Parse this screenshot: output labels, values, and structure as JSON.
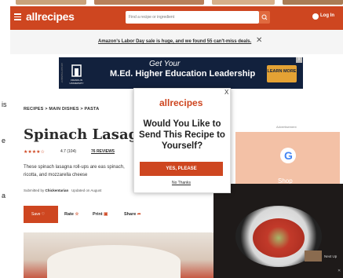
{
  "left_strip": {
    "lines": [
      "is",
      "e",
      "a"
    ]
  },
  "header": {
    "logo": "allrecipes",
    "search_placeholder": "Find a recipe or ingredient",
    "login_label": "Log In",
    "accent": "#ce4620"
  },
  "promo": {
    "text": "Amazon's Labor Day sale is huge, and we found 55 can't-miss deals.",
    "close": "✕"
  },
  "ad_banner": {
    "brand": "FRANKLIN",
    "brand_sub": "UNIVERSITY",
    "line1": "Get Your",
    "line2": "M.Ed. Higher Education Leadership",
    "cta": "LEARN MORE",
    "close": "X"
  },
  "article": {
    "breadcrumb": "RECIPES  >  MAIN DISHES  >  PASTA",
    "title": "Spinach Lasag",
    "stars": "★★★★☆",
    "rating": "4.7 (104)",
    "reviews": "76 REVIEWS",
    "description": "These spinach lasagna roll-ups are eas spinach, ricotta, and mozzarella cheese",
    "byline_prefix": "Submitted by",
    "byline_author": "Chickentarian",
    "byline_updated": "Updated on August",
    "actions": {
      "save": "Save",
      "rate": "Rate",
      "print": "Print",
      "share": "Share"
    }
  },
  "side_ad": {
    "label": "Advertisement",
    "g": "G",
    "txt": "Shop"
  },
  "video": {
    "next_up": "Next Up",
    "close": "✕"
  },
  "modal": {
    "close": "X",
    "logo": "allrecipes",
    "question": "Would You Like to Send This Recipe to Yourself?",
    "yes": "YES, PLEASE",
    "no": "No Thanks"
  }
}
